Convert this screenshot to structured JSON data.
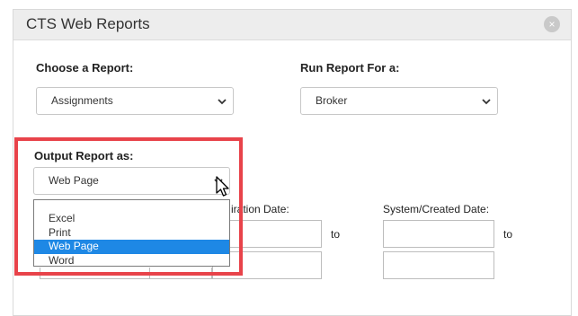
{
  "dialog": {
    "title": "CTS Web Reports",
    "close_glyph": "×"
  },
  "choose_report": {
    "label": "Choose a Report:",
    "value": "Assignments"
  },
  "run_for": {
    "label": "Run Report For a:",
    "value": "Broker"
  },
  "output": {
    "label": "Output Report as:",
    "value": "Web Page",
    "options": [
      "Excel",
      "Print",
      "Web Page",
      "Word"
    ],
    "selected_index": 2
  },
  "expiration": {
    "label": "iration Date:",
    "to": "to"
  },
  "system_created": {
    "label": "System/Created Date:",
    "to": "to"
  },
  "colors": {
    "highlight": "#e8434a",
    "selected_option": "#1e88e5"
  },
  "icons": {
    "close": "close-icon",
    "chevron": "chevron-down-icon",
    "cursor": "mouse-pointer-icon"
  }
}
